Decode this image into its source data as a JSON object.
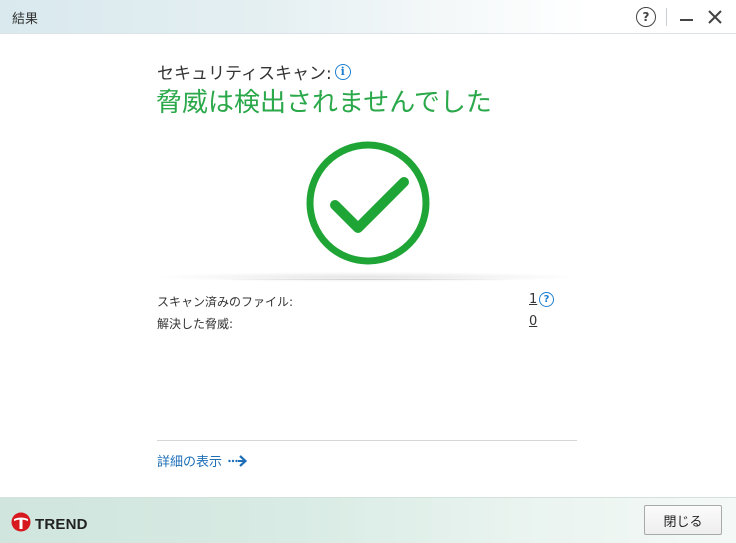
{
  "window": {
    "title": "結果",
    "help_label": "?"
  },
  "scan": {
    "label": "セキュリティスキャン:",
    "info_icon": "i",
    "result": "脅威は検出されませんでした",
    "status_color": "#2aa84a"
  },
  "stats": {
    "rows": [
      {
        "label": "スキャン済みのファイル:",
        "value": "1"
      },
      {
        "label": "解決した脅威:",
        "value": "0"
      }
    ],
    "help_icon": "?"
  },
  "details": {
    "label": "詳細の表示"
  },
  "footer": {
    "brand": "TREND",
    "close_button": "閉じる"
  },
  "icons": [
    "help-icon",
    "minimize-icon",
    "close-icon",
    "info-icon",
    "checkmark-icon",
    "arrow-right-icon",
    "trend-logo-icon"
  ]
}
